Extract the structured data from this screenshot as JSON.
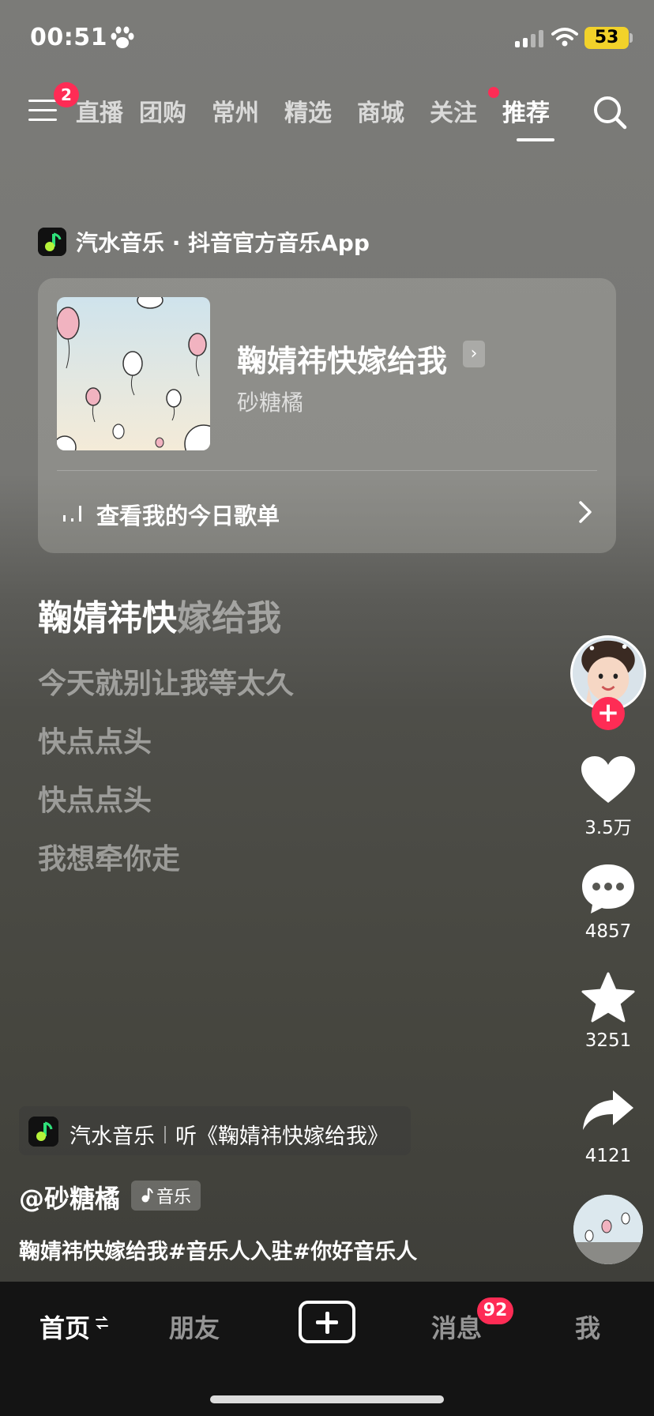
{
  "status_bar": {
    "time": "00:51",
    "paw_icon": "paw-icon",
    "battery": "53",
    "battery_color": "#f2d22a"
  },
  "top_nav": {
    "menu_badge": "2",
    "tabs": [
      "直播",
      "团购",
      "常州",
      "精选",
      "商城",
      "关注",
      "推荐"
    ],
    "active_tab": "推荐",
    "search_icon": "search-icon"
  },
  "music_card": {
    "app_line": "汽水音乐 · 抖音官方音乐App",
    "song_title": "鞠婧祎快嫁给我",
    "arrow": "›",
    "artist": "砂糖橘",
    "playlist_label": "查看我的今日歌单"
  },
  "lyrics": {
    "current_sung": "鞠婧祎快",
    "current_unsung": "嫁给我",
    "lines": [
      "今天就别让我等太久",
      "快点点头",
      "快点点头",
      "我想牵你走"
    ]
  },
  "actions": {
    "follow_plus": "+",
    "likes": "3.5万",
    "comments": "4857",
    "favorites": "3251",
    "shares": "4121"
  },
  "video_info": {
    "anchor_app": "汽水音乐",
    "anchor_song": "听《鞠婧祎快嫁给我》",
    "author": "@砂糖橘",
    "music_tag": "音乐",
    "description": "鞠婧祎快嫁给我#音乐人入驻#你好音乐人"
  },
  "bottom_tabs": {
    "home": "首页",
    "friends": "朋友",
    "messages": "消息",
    "messages_badge": "92",
    "me": "我"
  },
  "colors": {
    "accent": "#fe2c55",
    "tabbar_bg": "#141414"
  }
}
